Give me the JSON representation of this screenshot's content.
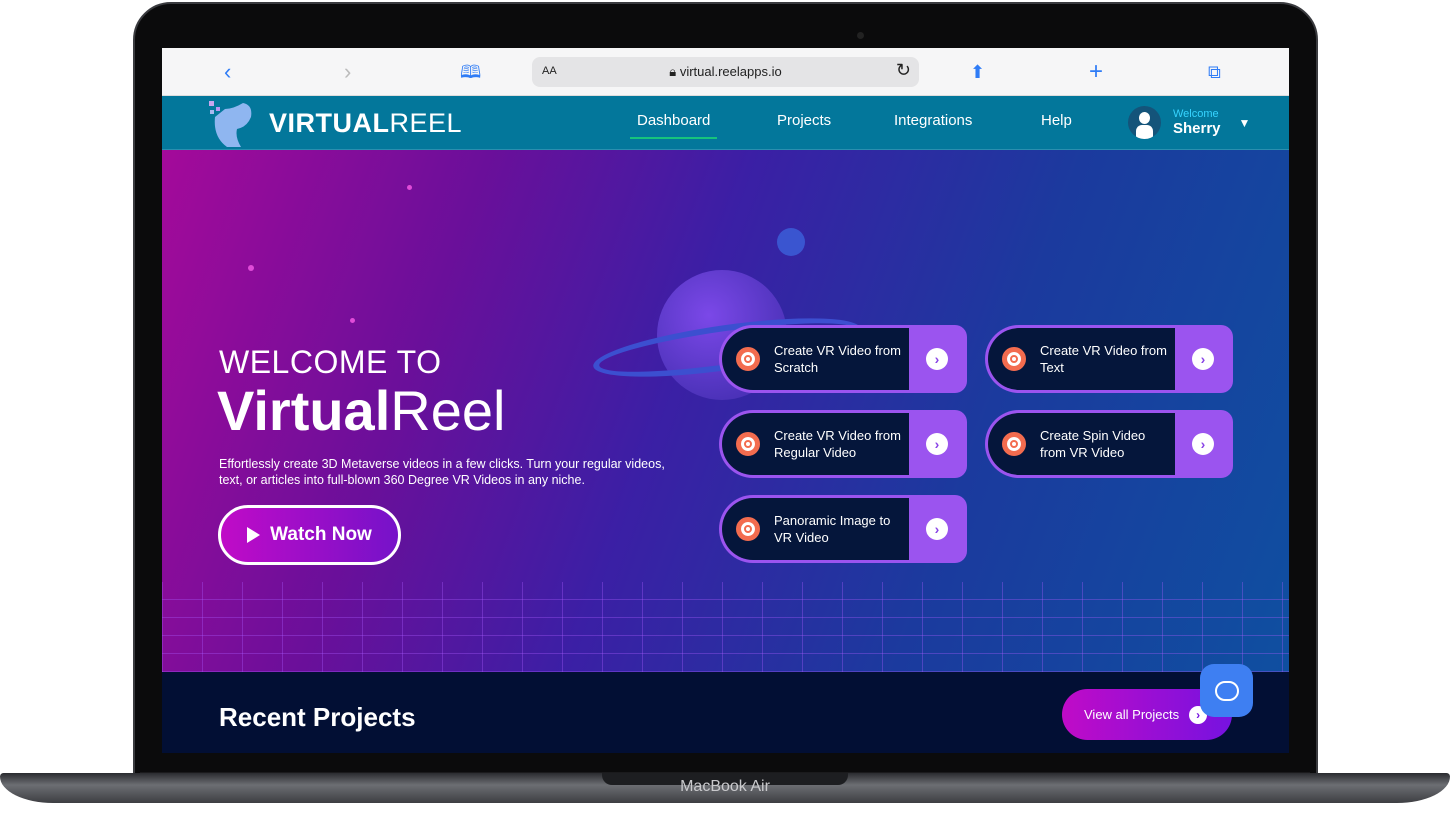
{
  "device": {
    "brand": "MacBook Air"
  },
  "browser": {
    "url": "virtual.reelapps.io",
    "text_size_label": "AA"
  },
  "nav": {
    "logo_bold": "VIRTUAL",
    "logo_light": "REEL",
    "items": [
      {
        "label": "Dashboard",
        "active": true
      },
      {
        "label": "Projects"
      },
      {
        "label": "Integrations"
      },
      {
        "label": "Help"
      }
    ],
    "user": {
      "greeting": "Welcome",
      "name": "Sherry"
    }
  },
  "hero": {
    "kicker": "WELCOME TO",
    "title_bold": "Virtual",
    "title_light": "Reel",
    "description": "Effortlessly create 3D Metaverse videos in a few clicks. Turn your regular videos, text, or articles into full-blown 360 Degree VR Videos in any niche.",
    "watch_label": "Watch Now",
    "cards": [
      {
        "label": "Create VR Video from Scratch"
      },
      {
        "label": "Create VR Video from Text"
      },
      {
        "label": "Create VR Video from Regular Video"
      },
      {
        "label": "Create Spin Video from VR Video"
      },
      {
        "label": "Panoramic Image to VR Video"
      }
    ]
  },
  "recent": {
    "title": "Recent Projects",
    "view_all_label": "View all Projects"
  },
  "colors": {
    "nav": "#03779b",
    "card_accent": "#9b54ef",
    "card_bg": "#05163b",
    "bottom": "#020f34",
    "chat": "#3e7ff2"
  }
}
